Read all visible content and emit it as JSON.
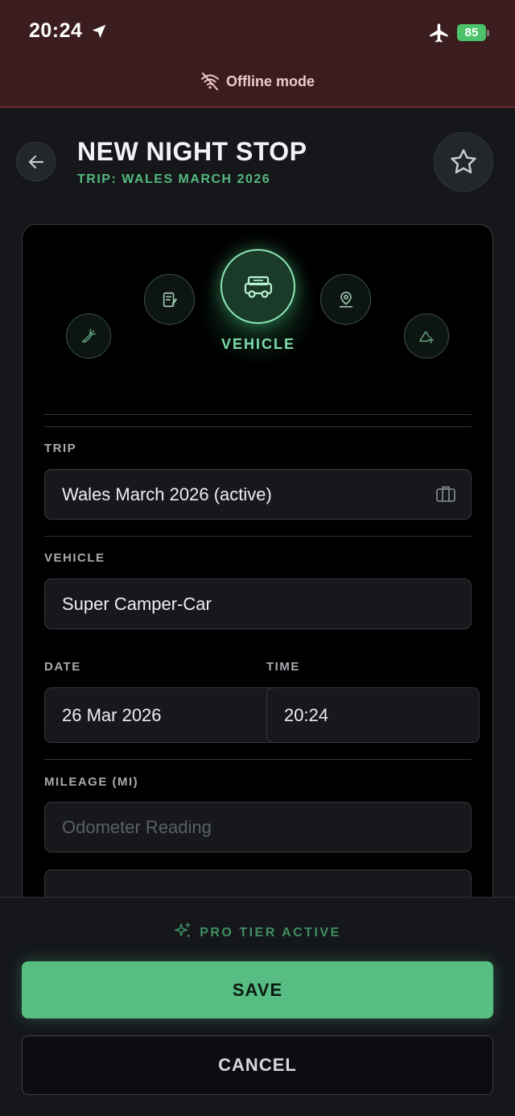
{
  "status_bar": {
    "time": "20:24",
    "battery": "85"
  },
  "banner": {
    "offline_label": "Offline mode"
  },
  "header": {
    "title": "NEW NIGHT STOP",
    "subtitle": "TRIP: WALES MARCH 2026"
  },
  "type_selector": {
    "selected_label": "VEHICLE",
    "items": [
      {
        "icon": "carrot-icon"
      },
      {
        "icon": "note-icon"
      },
      {
        "icon": "vehicle-icon"
      },
      {
        "icon": "map-pin-icon"
      },
      {
        "icon": "mountain-icon"
      }
    ]
  },
  "form": {
    "trip": {
      "label": "TRIP",
      "value": "Wales March 2026 (active)",
      "icon": "suitcase-icon"
    },
    "vehicle": {
      "label": "VEHICLE",
      "value": "Super Camper-Car"
    },
    "date": {
      "label": "DATE",
      "value": "26 Mar 2026"
    },
    "time": {
      "label": "TIME",
      "value": "20:24"
    },
    "mileage": {
      "label": "MILEAGE (MI)",
      "placeholder": "Odometer Reading"
    }
  },
  "footer": {
    "pro_label": "PRO TIER ACTIVE",
    "save_label": "SAVE",
    "cancel_label": "CANCEL"
  },
  "colors": {
    "accent": "#57bd82",
    "banner_bg": "#3b1d1f",
    "background": "#15171b"
  }
}
